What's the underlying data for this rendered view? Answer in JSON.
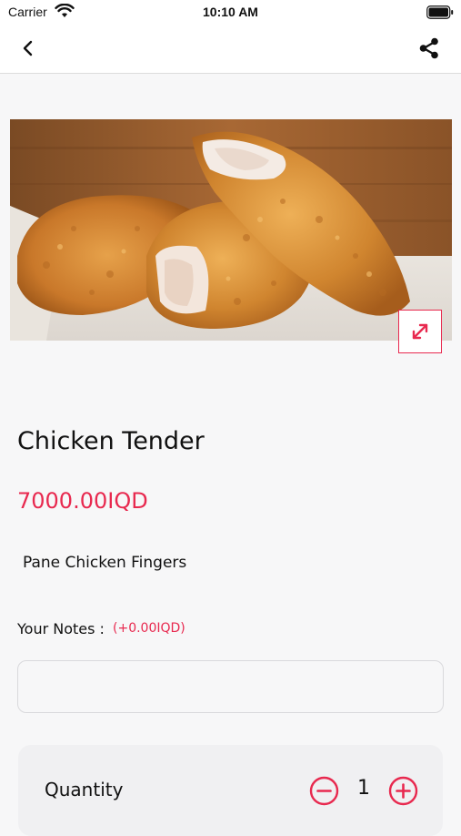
{
  "status_bar": {
    "carrier": "Carrier",
    "time": "10:10 AM"
  },
  "nav": {
    "back_icon": "chevron-left-icon",
    "share_icon": "share-icon"
  },
  "product": {
    "image_description_icon": "product-image",
    "name": "Chicken Tender",
    "price": "7000.00IQD",
    "description": "Pane Chicken Fingers"
  },
  "notes": {
    "label": "Your Notes :",
    "extra_price": "(+0.00IQD)",
    "value": "",
    "placeholder": ""
  },
  "quantity": {
    "label": "Quantity",
    "value": "1"
  },
  "colors": {
    "accent": "#e8294f",
    "background": "#f7f7f8",
    "card": "#f0f0f2"
  }
}
